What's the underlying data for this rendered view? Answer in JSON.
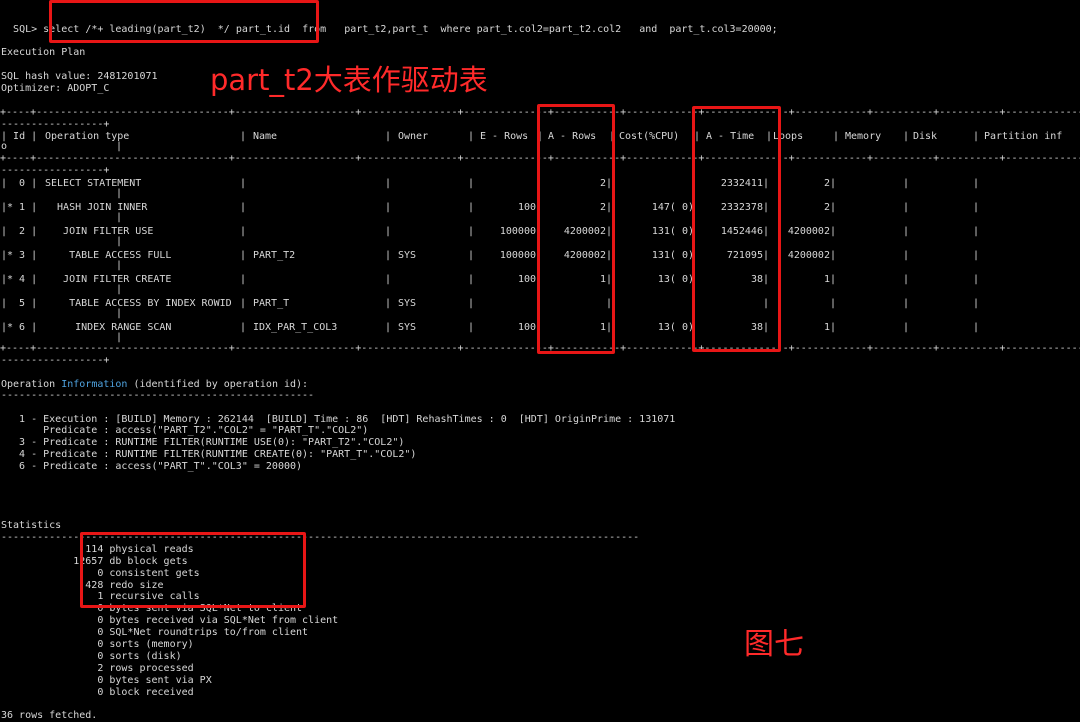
{
  "sql": {
    "prompt": "SQL> ",
    "part1": "select ",
    "hint": "/*+ leading(part_t2)  */",
    "part2": " part_t.id ",
    "part3": " from   part_t2,part_t  where part_t.col2=part_t2.col2   and  part_t.col3=20000;"
  },
  "plan": {
    "title": "Execution Plan",
    "dash_line": "------------------------------------------------------------------------",
    "hash": "SQL hash value: 2481201071",
    "optimizer": "Optimizer: ADOPT_C",
    "headers": {
      "id": "Id",
      "id_tail": "o",
      "op": "Operation type",
      "name": "Name",
      "owner": "Owner",
      "erows": "E - Rows",
      "arows": "A - Rows",
      "cost": "Cost(%CPU)",
      "atime": "A - Time",
      "loops": "Loops",
      "memory": "Memory",
      "disk": "Disk",
      "partition": "Partition inf"
    },
    "rows": [
      {
        "id": "|  0 |",
        "op": "SELECT STATEMENT",
        "name": "",
        "owner": "",
        "erows": "",
        "arows": "2|",
        "cost": "",
        "atime": "2332411|",
        "loops": "2|"
      },
      {
        "id": "|* 1 |",
        "op": "  HASH JOIN INNER",
        "name": "",
        "owner": "",
        "erows": "100",
        "arows": "2|",
        "cost": "147( 0)",
        "atime": "2332378|",
        "loops": "2|"
      },
      {
        "id": "|  2 |",
        "op": "   JOIN FILTER USE",
        "name": "",
        "owner": "",
        "erows": "100000",
        "arows": "4200002|",
        "cost": "131( 0)",
        "atime": "1452446|",
        "loops": "4200002|"
      },
      {
        "id": "|* 3 |",
        "op": "    TABLE ACCESS FULL",
        "name": "PART_T2",
        "owner": "SYS",
        "erows": "100000",
        "arows": "4200002|",
        "cost": "131( 0)",
        "atime": "721095|",
        "loops": "4200002|"
      },
      {
        "id": "|* 4 |",
        "op": "   JOIN FILTER CREATE",
        "name": "",
        "owner": "",
        "erows": "100",
        "arows": "1|",
        "cost": "13( 0)",
        "atime": "38|",
        "loops": "1|"
      },
      {
        "id": "|  5 |",
        "op": "    TABLE ACCESS BY INDEX ROWID",
        "name": "PART_T",
        "owner": "SYS",
        "erows": "",
        "arows": "|",
        "cost": "",
        "atime": "|",
        "loops": "|"
      },
      {
        "id": "|* 6 |",
        "op": "     INDEX RANGE SCAN",
        "name": "IDX_PAR_T_COL3",
        "owner": "SYS",
        "erows": "100",
        "arows": "1|",
        "cost": "13( 0)",
        "atime": "38|",
        "loops": "1|"
      }
    ]
  },
  "opinfo": {
    "prefix": "Operation ",
    "highlight": "Information",
    "suffix": " (identified by operation id):",
    "underline": "----------------------------------------------------",
    "lines": [
      "   1 - Execution : [BUILD] Memory : 262144  [BUILD] Time : 86  [HDT] RehashTimes : 0  [HDT] OriginPrime : 131071",
      "       Predicate : access(\"PART_T2\".\"COL2\" = \"PART_T\".\"COL2\")",
      "   3 - Predicate : RUNTIME FILTER(RUNTIME USE(0): \"PART_T2\".\"COL2\")",
      "   4 - Predicate : RUNTIME FILTER(RUNTIME CREATE(0): \"PART_T\".\"COL2\")",
      "   6 - Predicate : access(\"PART_T\".\"COL3\" = 20000)"
    ]
  },
  "stats": {
    "title": "Statistics",
    "lines": [
      "              114 physical reads",
      "            12657 db block gets",
      "                0 consistent gets",
      "              428 redo size",
      "                1 recursive calls",
      "                0 bytes sent via SQL*Net to client",
      "                0 bytes received via SQL*Net from client",
      "                0 SQL*Net roundtrips to/from client",
      "                0 sorts (memory)",
      "                0 sorts (disk)",
      "                2 rows processed",
      "                0 bytes sent via PX",
      "                0 block received"
    ]
  },
  "footer": "36 rows fetched.",
  "annotations": {
    "driver": "part_t2大表作驱动表",
    "figure": "图七"
  },
  "colors": {
    "background": "#000000",
    "text": "#d8d8d8",
    "highlight": "#4fa3e0",
    "annotation": "#ff2a2a"
  }
}
